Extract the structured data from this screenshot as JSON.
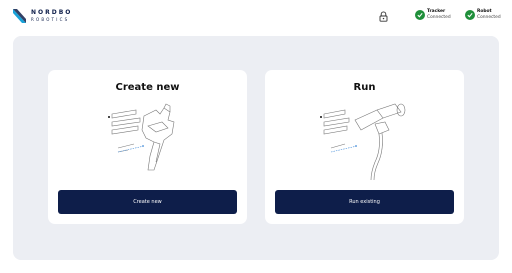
{
  "brand": {
    "name_line1": "NORDBO",
    "name_line2": "ROBOTICS",
    "primary_color": "#0e1e4a"
  },
  "header": {
    "lock_icon": "lock-icon",
    "tracker": {
      "name": "Tracker",
      "status": "Connected",
      "icon": "check-circle-icon",
      "color": "#1f8f3a"
    },
    "robot": {
      "name": "Robot",
      "status": "Connected",
      "icon": "check-circle-icon",
      "color": "#1f8f3a"
    }
  },
  "cards": {
    "create": {
      "title": "Create new",
      "button_label": "Create new",
      "illustration": "handheld-tracker-tool-illustration"
    },
    "run": {
      "title": "Run",
      "button_label": "Run existing",
      "illustration": "robot-spray-gun-illustration"
    }
  }
}
